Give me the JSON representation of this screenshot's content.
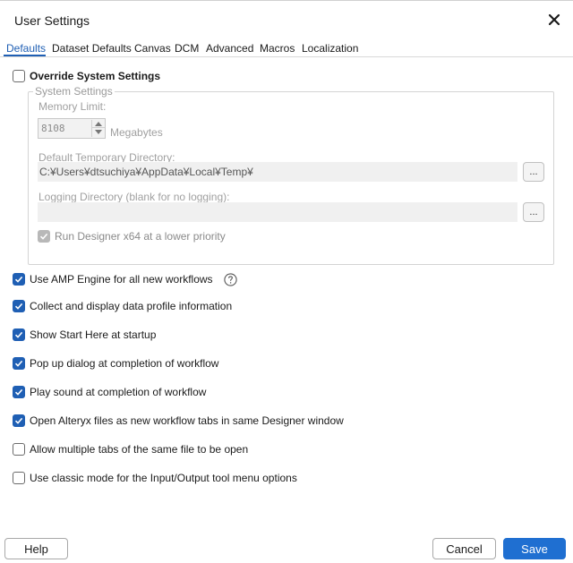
{
  "window": {
    "title": "User Settings"
  },
  "tabs": [
    {
      "label": "Defaults",
      "active": true
    },
    {
      "label": "Dataset Defaults",
      "active": false
    },
    {
      "label": "Canvas",
      "active": false
    },
    {
      "label": "DCM",
      "active": false
    },
    {
      "label": "Advanced",
      "active": false
    },
    {
      "label": "Macros",
      "active": false
    },
    {
      "label": "Localization",
      "active": false
    }
  ],
  "override": {
    "label": "Override System Settings",
    "checked": false
  },
  "system_settings": {
    "legend": "System Settings",
    "memory_limit_label": "Memory Limit:",
    "memory_limit_value": "8108",
    "memory_unit": "Megabytes",
    "temp_dir_label": "Default Temporary Directory:",
    "temp_dir_value": "C:¥Users¥dtsuchiya¥AppData¥Local¥Temp¥",
    "logging_dir_label": "Logging Directory (blank for no logging):",
    "logging_dir_value": "",
    "browse_label": "...",
    "low_priority_label": "Run Designer x64 at a lower priority",
    "low_priority_checked": true
  },
  "options": [
    {
      "label": "Use AMP Engine for all new workflows",
      "checked": true
    },
    {
      "label": "Collect and display data profile information",
      "checked": true
    },
    {
      "label": "Show Start Here at startup",
      "checked": true
    },
    {
      "label": "Pop up dialog at completion of workflow",
      "checked": true
    },
    {
      "label": "Play sound at completion of workflow",
      "checked": true
    },
    {
      "label": "Open Alteryx files as new workflow tabs in same Designer window",
      "checked": true
    },
    {
      "label": "Allow multiple tabs of the same file to be open",
      "checked": false
    },
    {
      "label": "Use classic mode for the Input/Output tool menu options",
      "checked": false
    }
  ],
  "footer": {
    "help_label": "Help",
    "cancel_label": "Cancel",
    "save_label": "Save"
  },
  "colors": {
    "accent": "#1f5fb4",
    "primary_button": "#1f6fd1",
    "disabled_text": "#a0a0a0"
  },
  "icons": {
    "close": "close-icon",
    "help": "help-circle-icon",
    "check": "checkmark-icon"
  }
}
